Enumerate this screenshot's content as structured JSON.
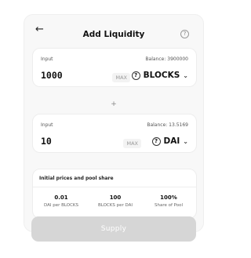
{
  "header": {
    "title": "Add Liquidity",
    "back_icon": "arrow-left-icon",
    "help_icon": "question-icon"
  },
  "input_panel": {
    "label": "Input",
    "balance": "Balance: 3900000",
    "amount": "1000",
    "max_label": "MAX",
    "token": "BLOCKS"
  },
  "plus_symbol": "+",
  "output_panel": {
    "label": "Input",
    "balance": "Balance: 13.5169",
    "amount": "10",
    "max_label": "MAX",
    "token": "DAI"
  },
  "prices": {
    "heading": "Initial prices and pool share",
    "stats": [
      {
        "value": "0.01",
        "label": "DAI per BLOCKS"
      },
      {
        "value": "100",
        "label": "BLOCKS per DAI"
      },
      {
        "value": "100%",
        "label": "Share of Pool"
      }
    ]
  },
  "supply_button": "Supply",
  "colors": {
    "card_bg": "#f8f8f8",
    "button_disabled": "#d6d6d6"
  }
}
